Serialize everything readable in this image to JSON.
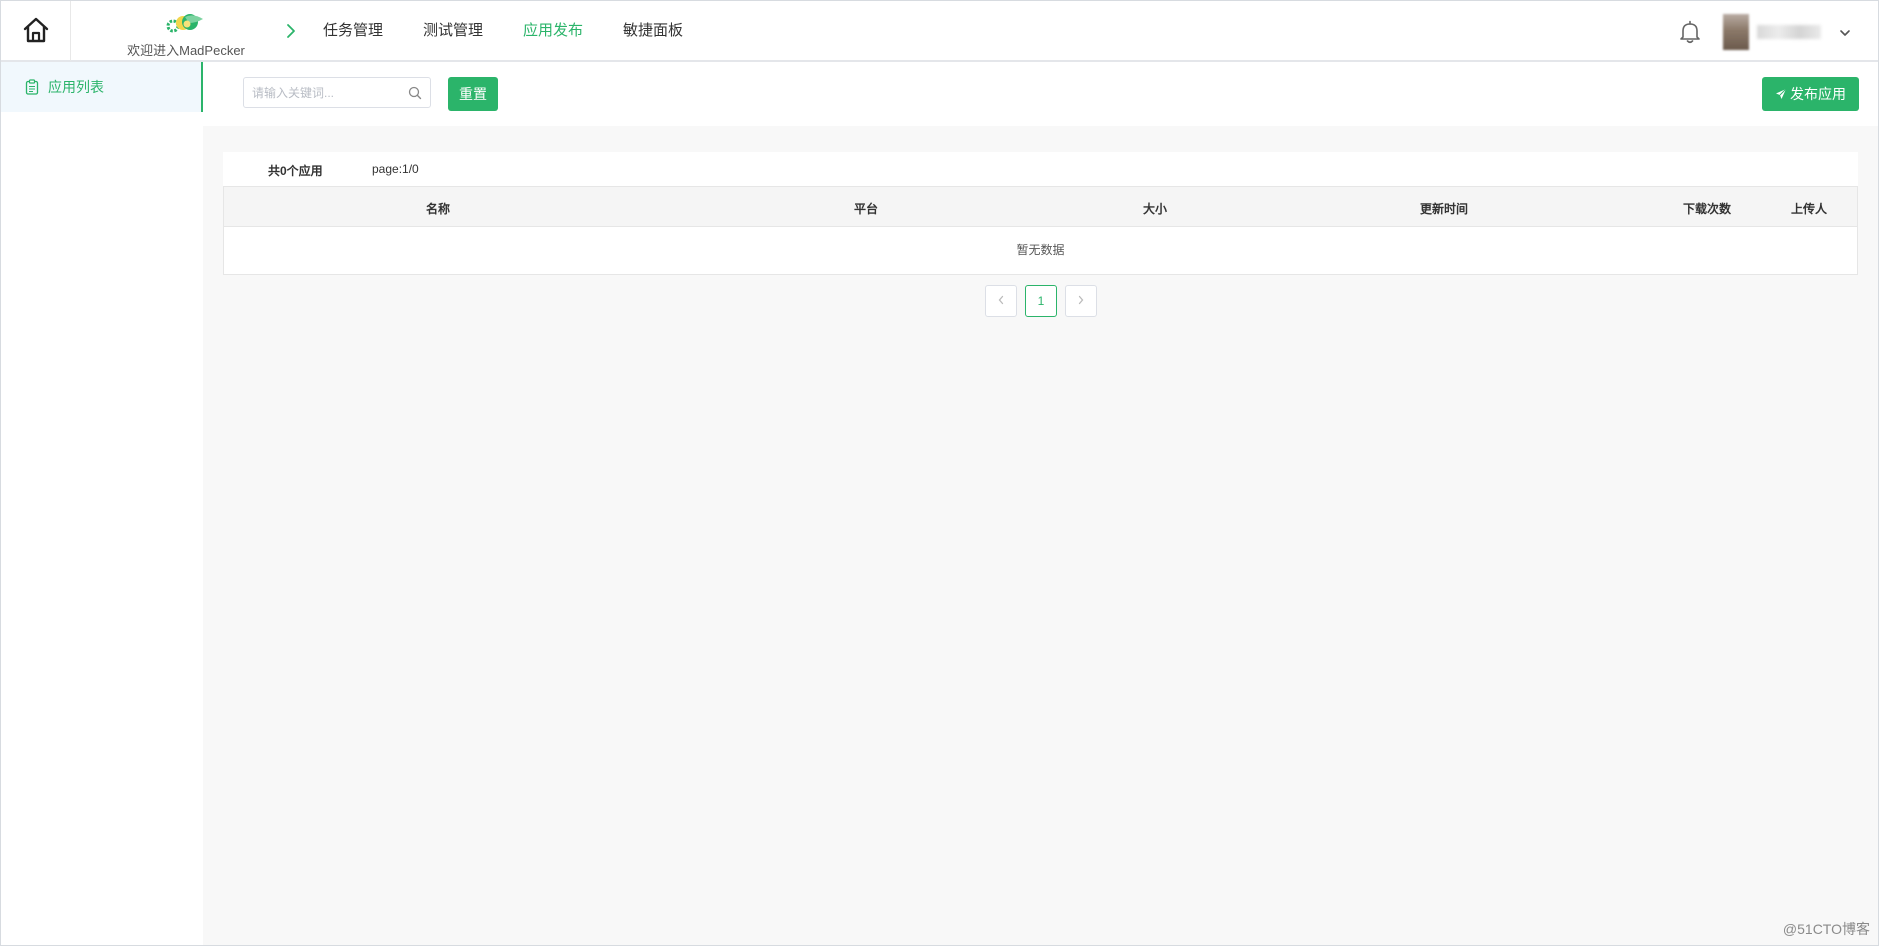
{
  "header": {
    "welcome_text": "欢迎进入MadPecker",
    "nav": [
      {
        "label": "任务管理",
        "active": false
      },
      {
        "label": "测试管理",
        "active": false
      },
      {
        "label": "应用发布",
        "active": true
      },
      {
        "label": "敏捷面板",
        "active": false
      }
    ],
    "icons": [
      "home-icon",
      "logo-icon",
      "chevron-right-icon",
      "bell-icon",
      "chevron-down-icon"
    ]
  },
  "sidebar": {
    "items": [
      {
        "label": "应用列表",
        "icon": "clipboard-icon",
        "active": true
      }
    ],
    "collapse_icon": "chevron-left-icon"
  },
  "toolbar": {
    "search_placeholder": "请输入关键词...",
    "search_value": "",
    "reset_label": "重置",
    "publish_label": "发布应用",
    "publish_icon": "send-icon"
  },
  "summary": {
    "count_text": "共0个应用",
    "page_text": "page:1/0"
  },
  "table": {
    "columns": [
      "名称",
      "平台",
      "大小",
      "更新时间",
      "下载次数",
      "上传人"
    ],
    "rows": [],
    "empty_text": "暂无数据"
  },
  "pagination": {
    "current": "1"
  },
  "watermark": "@51CTO博客",
  "colors": {
    "accent": "#2bb46a",
    "main_bg": "#f8f8f8",
    "sidebar_active_bg": "#f1f8fd"
  }
}
